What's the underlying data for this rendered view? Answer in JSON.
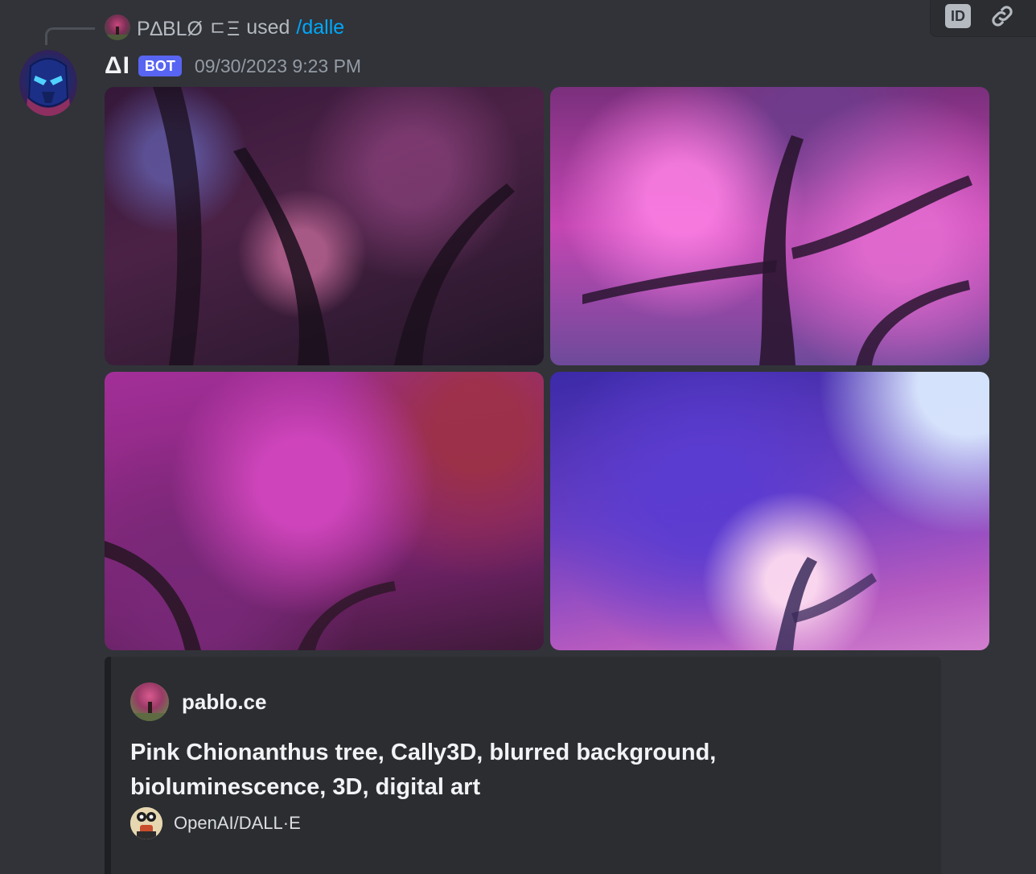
{
  "command": {
    "user": "P∆BLØ ㄷΞ",
    "used": "used",
    "name": "/dalle"
  },
  "toolbar": {
    "id_label": "ID",
    "link_icon": "link-icon"
  },
  "message": {
    "author": "ΔI",
    "tag": "BOT",
    "timestamp": "09/30/2023 9:23 PM"
  },
  "embed": {
    "author": "pablo.ce",
    "description": "Pink Chionanthus tree, Cally3D, blurred background, bioluminescence, 3D, digital art",
    "footer": "OpenAI/DALL·E"
  },
  "colors": {
    "background": "#313338",
    "embed_bg": "#2b2d31",
    "command_accent": "#00a8fc",
    "bot_tag": "#5865f2",
    "timestamp": "#949ba4"
  }
}
